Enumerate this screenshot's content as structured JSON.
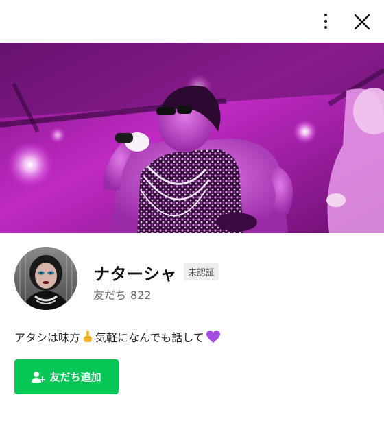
{
  "header": {
    "menu_icon": "more-vertical-icon",
    "close_icon": "close-icon"
  },
  "profile": {
    "name": "ナターシャ",
    "badge": "未認証",
    "friends_label": "友だち",
    "friends_count": "822",
    "status_before": "アタシは味方",
    "status_middle": "気軽になんでも話して",
    "add_friend_label": "友だち追加"
  },
  "colors": {
    "accent": "#06c755",
    "cover": "#8e1a8f"
  }
}
